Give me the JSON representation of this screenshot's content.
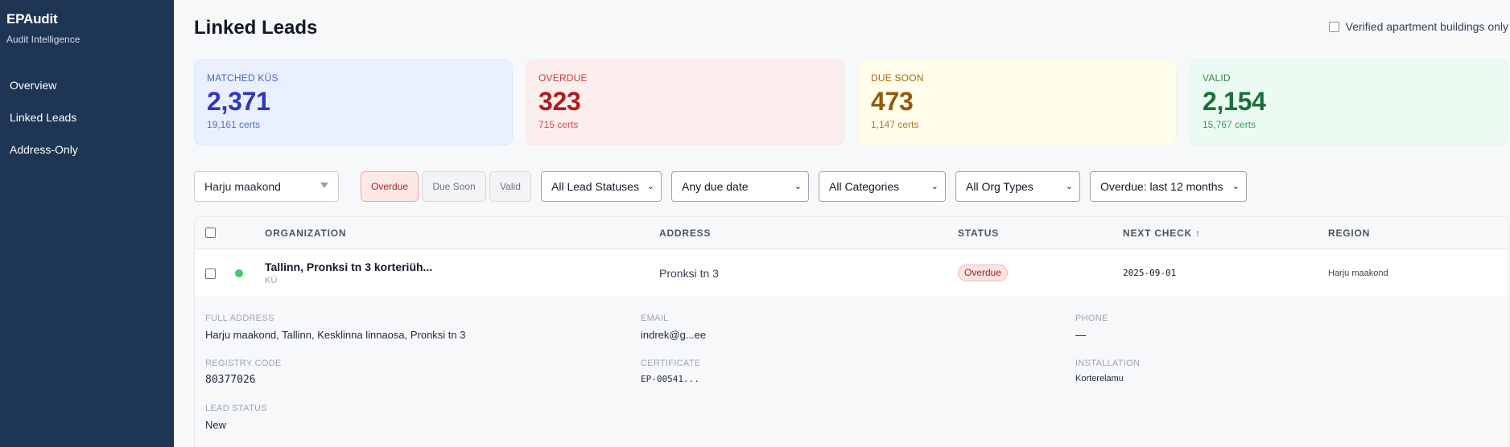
{
  "app": {
    "name": "EPAudit",
    "subtitle": "Audit Intelligence"
  },
  "sidebar": {
    "items": [
      {
        "label": "Overview"
      },
      {
        "label": "Linked Leads"
      },
      {
        "label": "Address-Only"
      }
    ]
  },
  "header": {
    "title": "Linked Leads",
    "verified_only_label": "Verified apartment buildings only",
    "verified_only_checked": false
  },
  "stats": [
    {
      "label": "MATCHED KÜS",
      "value": "2,371",
      "sub": "19,161 certs",
      "color": "#3037b8"
    },
    {
      "label": "OVERDUE",
      "value": "323",
      "sub": "715 certs",
      "color": "#b01c1c"
    },
    {
      "label": "DUE SOON",
      "value": "473",
      "sub": "1,147 certs",
      "color": "#95590e"
    },
    {
      "label": "VALID",
      "value": "2,154",
      "sub": "15,767 certs",
      "color": "#1b6f3a"
    }
  ],
  "filters": {
    "region": "Harju maakond",
    "status_toggles": [
      {
        "label": "Overdue",
        "active": true
      },
      {
        "label": "Due Soon",
        "active": false
      },
      {
        "label": "Valid",
        "active": false
      }
    ],
    "lead_status": "All Lead Statuses",
    "due_date": "Any due date",
    "category": "All Categories",
    "org_type": "All Org Types",
    "overdue_window": "Overdue: last 12 months"
  },
  "table": {
    "columns": {
      "organization": "ORGANIZATION",
      "address": "ADDRESS",
      "status": "STATUS",
      "next_check": "NEXT CHECK ↑",
      "region": "REGION"
    },
    "rows": [
      {
        "organization": "Tallinn, Pronksi tn 3 korteriüh...",
        "org_type": "KÜ",
        "address": "Pronksi tn 3",
        "status": "Overdue",
        "next_check": "2025-09-01",
        "region": "Harju maakond",
        "details": {
          "full_address_label": "FULL ADDRESS",
          "full_address": "Harju maakond, Tallinn, Kesklinna linnaosa, Pronksi tn 3",
          "email_label": "EMAIL",
          "email": "indrek@g...ee",
          "phone_label": "PHONE",
          "phone": "—",
          "registry_code_label": "REGISTRY CODE",
          "registry_code": "80377026",
          "certificate_label": "CERTIFICATE",
          "certificate": "EP-00541...",
          "installation_label": "INSTALLATION",
          "installation": "Korterelamu",
          "lead_status_label": "LEAD STATUS",
          "lead_status": "New"
        }
      }
    ]
  }
}
